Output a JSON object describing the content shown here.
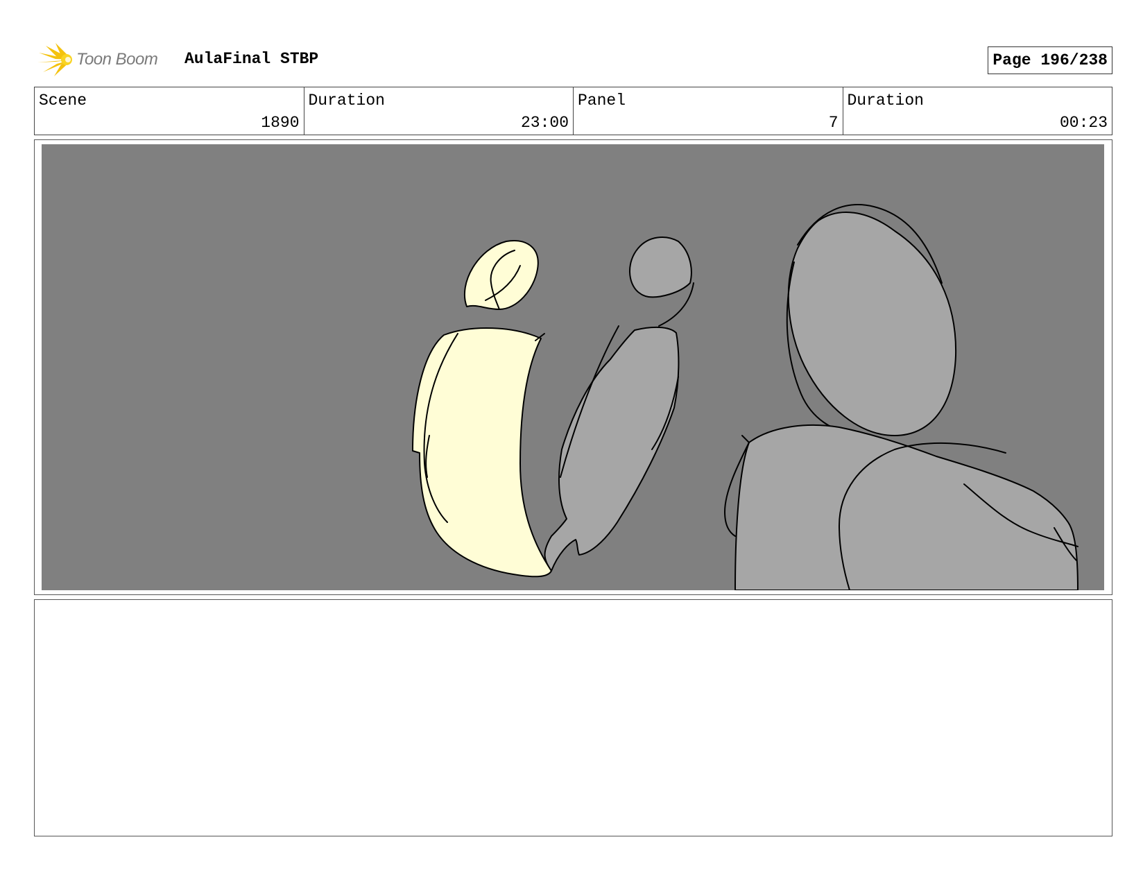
{
  "header": {
    "logo_text": "Toon Boom",
    "project_title": "AulaFinal STBP",
    "page_label": "Page 196/238"
  },
  "info": {
    "scene_label": "Scene",
    "scene_value": "1890",
    "scene_duration_label": "Duration",
    "scene_duration_value": "23:00",
    "panel_label": "Panel",
    "panel_value": "7",
    "panel_duration_label": "Duration",
    "panel_duration_value": "00:23"
  },
  "panel": {
    "background_color": "#808080",
    "figure_yellow_color": "#FFFDD6",
    "figure_gray_color": "#A6A6A6"
  },
  "notes": {
    "text": ""
  }
}
